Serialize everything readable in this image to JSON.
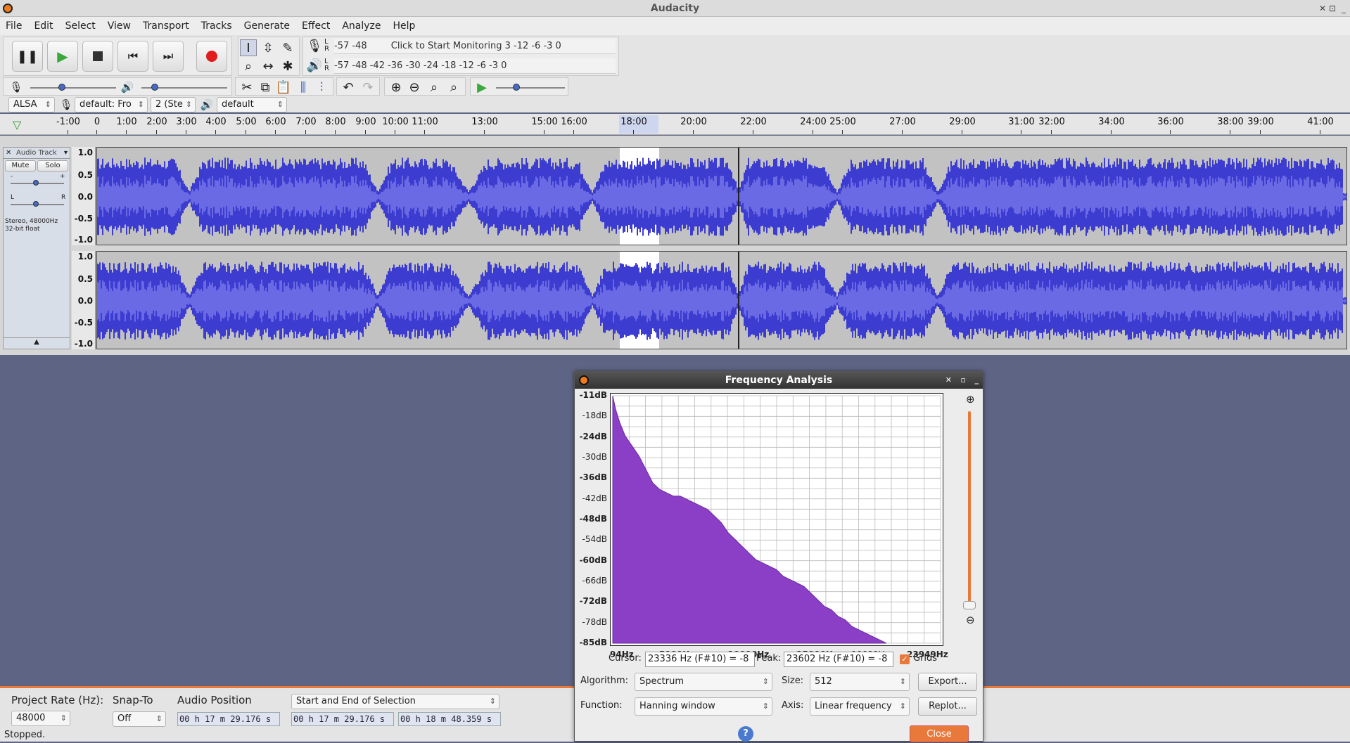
{
  "window": {
    "title": "Audacity"
  },
  "menu": [
    "File",
    "Edit",
    "Select",
    "View",
    "Transport",
    "Tracks",
    "Generate",
    "Effect",
    "Analyze",
    "Help"
  ],
  "meters": {
    "record_hint": "Click to Start Monitoring",
    "scale_a": "-57 -48",
    "scale_rec_tail": "3 -12 -6 -3 0",
    "scale_play": "-57 -48 -42 -36 -30 -24 -18 -12 -6 -3 0",
    "lr": "L R"
  },
  "device": {
    "host": "ALSA",
    "input": "default: Fro",
    "channels": "2 (Ste",
    "output": "default"
  },
  "ruler": {
    "ticks": [
      [
        "-1:00",
        97
      ],
      [
        "0",
        138
      ],
      [
        "1:00",
        180
      ],
      [
        "2:00",
        223
      ],
      [
        "3:00",
        265
      ],
      [
        "4:00",
        307
      ],
      [
        "5:00",
        350
      ],
      [
        "6:00",
        392
      ],
      [
        "7:00",
        435
      ],
      [
        "8:00",
        477
      ],
      [
        "9:00",
        520
      ],
      [
        "10:00",
        562
      ],
      [
        "11:00",
        604
      ],
      [
        "13:00",
        689
      ],
      [
        "15:00",
        774
      ],
      [
        "16:00",
        816
      ],
      [
        "18:00",
        901
      ],
      [
        "20:00",
        986
      ],
      [
        "22:00",
        1071
      ],
      [
        "24:00",
        1156
      ],
      [
        "25:00",
        1198
      ],
      [
        "27:00",
        1283
      ],
      [
        "29:00",
        1368
      ],
      [
        "31:00",
        1452
      ],
      [
        "32:00",
        1495
      ],
      [
        "34:00",
        1580
      ],
      [
        "36:00",
        1664
      ],
      [
        "38:00",
        1749
      ],
      [
        "39:00",
        1792
      ],
      [
        "41:00",
        1877
      ]
    ]
  },
  "track": {
    "name": "Audio Track",
    "mute": "Mute",
    "solo": "Solo",
    "info1": "Stereo, 48000Hz",
    "info2": "32-bit float",
    "pan_l": "L",
    "pan_r": "R",
    "gain_minus": "-",
    "gain_plus": "+"
  },
  "scale": [
    "1.0",
    "0.5",
    "0.0",
    "-0.5",
    "-1.0"
  ],
  "bottom": {
    "rate_label": "Project Rate (Hz):",
    "rate": "48000",
    "snap_label": "Snap-To",
    "snap": "Off",
    "pos_label": "Audio Position",
    "sel_mode": "Start and End of Selection",
    "pos": "00 h 17 m 29.176 s",
    "sel_start": "00 h 17 m 29.176 s",
    "sel_end": "00 h 18 m 48.359 s",
    "status": "Stopped."
  },
  "dialog": {
    "title": "Frequency Analysis",
    "db_labels": [
      "-11dB",
      "-18dB",
      "-24dB",
      "-30dB",
      "-36dB",
      "-42dB",
      "-48dB",
      "-54dB",
      "-60dB",
      "-66dB",
      "-72dB",
      "-78dB",
      "-85dB"
    ],
    "hz_labels": [
      "94Hz",
      "5000Hz",
      "10000Hz",
      "15000Hz",
      "19000Hz",
      "23949Hz"
    ],
    "cursor_label": "Cursor:",
    "cursor": "23336 Hz (F#10) = -8",
    "peak_label": "Peak:",
    "peak": "23602 Hz (F#10) = -8",
    "grids": "Grids",
    "algorithm_label": "Algorithm:",
    "algorithm": "Spectrum",
    "size_label": "Size:",
    "size": "512",
    "export": "Export...",
    "function_label": "Function:",
    "function": "Hanning window",
    "axis_label": "Axis:",
    "axis": "Linear frequency",
    "replot": "Replot...",
    "help": "?",
    "close": "Close"
  },
  "chart_data": {
    "type": "area",
    "xlabel": "",
    "ylabel": "",
    "x_unit": "Hz",
    "y_unit": "dB",
    "xlim": [
      94,
      23949
    ],
    "ylim": [
      -85,
      -11
    ],
    "x": [
      94,
      300,
      600,
      1000,
      1500,
      2000,
      2500,
      3000,
      3500,
      4000,
      4500,
      5000,
      5500,
      6000,
      6500,
      7000,
      7500,
      8000,
      8500,
      9000,
      9500,
      10000,
      10500,
      11000,
      11500,
      12000,
      12500,
      13000,
      13500,
      14000,
      14500,
      15000,
      15500,
      16000,
      16500,
      17000,
      17500,
      18000,
      18500,
      19000,
      19500,
      20000
    ],
    "values": [
      -11,
      -15,
      -19,
      -23,
      -26,
      -29,
      -33,
      -37,
      -39,
      -40,
      -41,
      -41,
      -42,
      -43,
      -44,
      -45,
      -47,
      -49,
      -52,
      -54,
      -56,
      -58,
      -60,
      -61,
      -62,
      -63,
      -65,
      -66,
      -67,
      -68,
      -70,
      -72,
      -74,
      -75,
      -77,
      -78,
      -80,
      -81,
      -82,
      -83,
      -84,
      -85
    ]
  }
}
